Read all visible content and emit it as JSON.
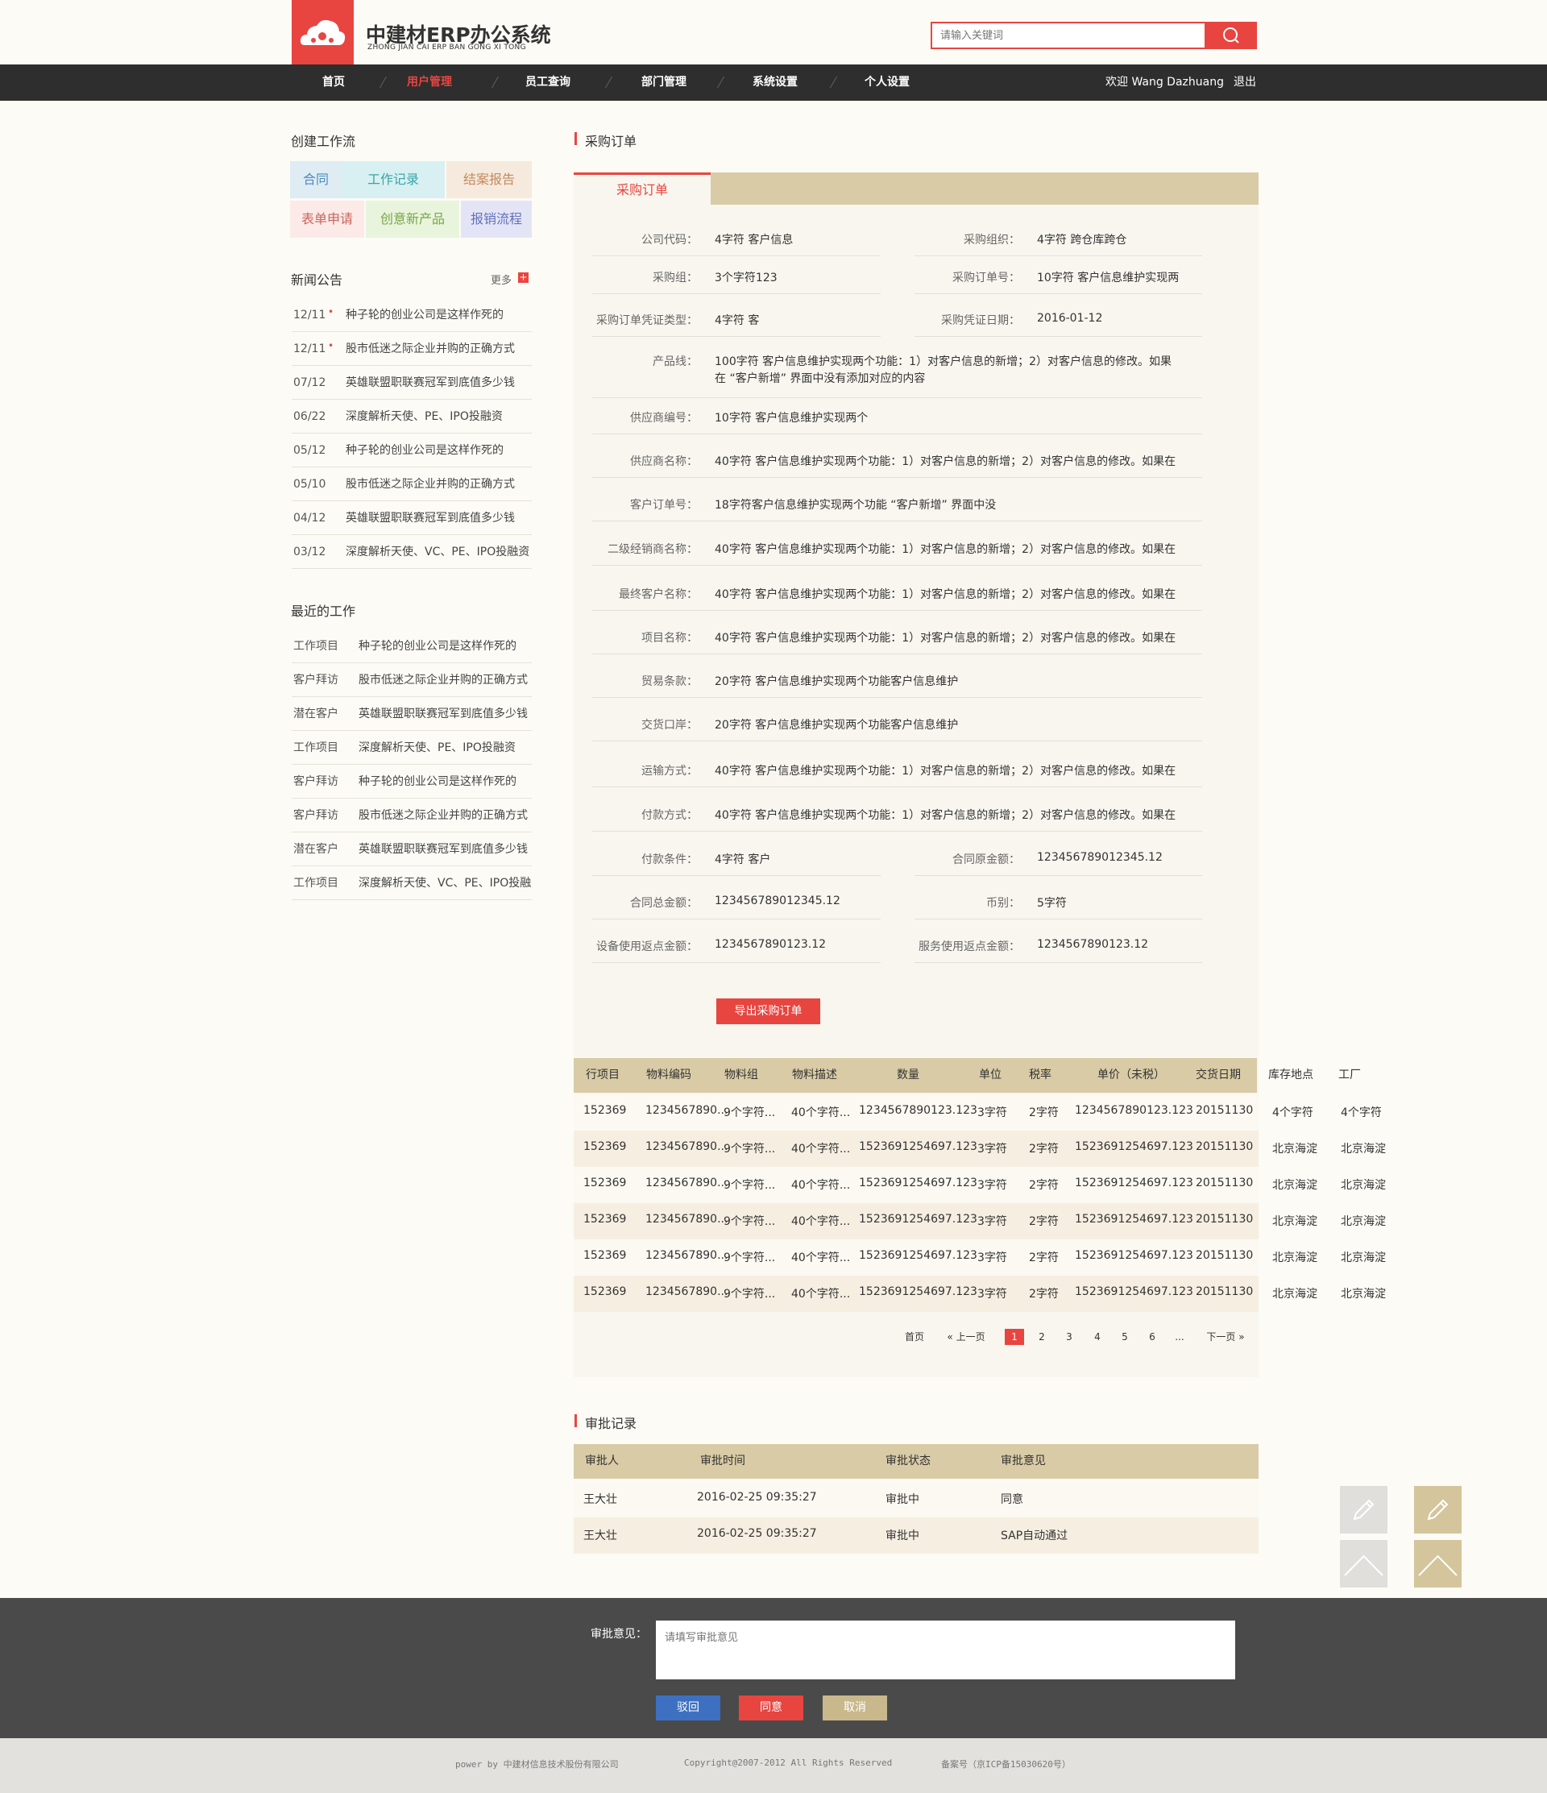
{
  "header": {
    "brand_title": "中建材ERP办公系统",
    "brand_sub": "ZHONG JIAN CAI ERP BAN GONG XI TONG",
    "search_placeholder": "请输入关键词"
  },
  "nav": {
    "items": [
      "首页",
      "用户管理",
      "员工查询",
      "部门管理",
      "系统设置",
      "个人设置"
    ],
    "active": "用户管理",
    "welcome": "欢迎 Wang Dazhuang",
    "logout": "退出"
  },
  "sidebar": {
    "workflow_title": "创建工作流",
    "workflow_tiles": [
      "合同",
      "工作记录",
      "结案报告",
      "表单申请",
      "创意新产品",
      "报销流程"
    ],
    "news_title": "新闻公告",
    "news_more": "更多",
    "news": [
      {
        "date": "12/11",
        "title": "种子轮的创业公司是这样作死的"
      },
      {
        "date": "12/11",
        "title": "股市低迷之际企业并购的正确方式"
      },
      {
        "date": "07/12",
        "title": "英雄联盟职联赛冠军到底值多少钱"
      },
      {
        "date": "06/22",
        "title": "深度解析天使、PE、IPO投融资"
      },
      {
        "date": "05/12",
        "title": "种子轮的创业公司是这样作死的"
      },
      {
        "date": "05/10",
        "title": "股市低迷之际企业并购的正确方式"
      },
      {
        "date": "04/12",
        "title": "英雄联盟职联赛冠军到底值多少钱"
      },
      {
        "date": "03/12",
        "title": "深度解析天使、VC、PE、IPO投融资"
      }
    ],
    "work_title": "最近的工作",
    "work": [
      {
        "type": "工作项目",
        "title": "种子轮的创业公司是这样作死的"
      },
      {
        "type": "客户拜访",
        "title": "股市低迷之际企业并购的正确方式"
      },
      {
        "type": "潜在客户",
        "title": "英雄联盟职联赛冠军到底值多少钱"
      },
      {
        "type": "工作项目",
        "title": "深度解析天使、PE、IPO投融资"
      },
      {
        "type": "客户拜访",
        "title": "种子轮的创业公司是这样作死的"
      },
      {
        "type": "客户拜访",
        "title": "股市低迷之际企业并购的正确方式"
      },
      {
        "type": "潜在客户",
        "title": "英雄联盟职联赛冠军到底值多少钱"
      },
      {
        "type": "工作项目",
        "title": "深度解析天使、VC、PE、IPO投融"
      }
    ]
  },
  "order": {
    "section_title": "采购订单",
    "tab_label": "采购订单",
    "fields": {
      "company_code": {
        "label": "公司代码：",
        "value": "4字符  客户信息"
      },
      "purchase_org": {
        "label": "采购组织：",
        "value": "4字符   跨仓库跨仓"
      },
      "purchase_group": {
        "label": "采购组：",
        "value": "3个字符123"
      },
      "order_no": {
        "label": "采购订单号：",
        "value": "10字符  客户信息维护实现两"
      },
      "voucher_type": {
        "label": "采购订单凭证类型：",
        "value": "4字符   客"
      },
      "voucher_date": {
        "label": "采购凭证日期：",
        "value": "2016-01-12"
      },
      "product_line": {
        "label": "产品线：",
        "value1": "100字符  客户信息维护实现两个功能：1）对客户信息的新增；2）对客户信息的修改。如果",
        "value2": "在 “客户新增” 界面中没有添加对应的内容"
      },
      "supplier_no": {
        "label": "供应商编号：",
        "value": "10字符 客户信息维护实现两个"
      },
      "supplier_name": {
        "label": "供应商名称：",
        "value": "40字符  客户信息维护实现两个功能：1）对客户信息的新增；2）对客户信息的修改。如果在"
      },
      "customer_order_no": {
        "label": "客户订单号：",
        "value": "18字符客户信息维护实现两个功能  “客户新增” 界面中没"
      },
      "dealer_name": {
        "label": "二级经销商名称：",
        "value": "40字符  客户信息维护实现两个功能：1）对客户信息的新增；2）对客户信息的修改。如果在"
      },
      "end_customer": {
        "label": "最终客户名称：",
        "value": "40字符  客户信息维护实现两个功能：1）对客户信息的新增；2）对客户信息的修改。如果在"
      },
      "project_name": {
        "label": "项目名称：",
        "value": "40字符  客户信息维护实现两个功能：1）对客户信息的新增；2）对客户信息的修改。如果在"
      },
      "trade_terms": {
        "label": "贸易条款：",
        "value": "20字符 客户信息维护实现两个功能客户信息维护"
      },
      "delivery_port": {
        "label": "交货口岸：",
        "value": "20字符 客户信息维护实现两个功能客户信息维护"
      },
      "shipping": {
        "label": "运输方式：",
        "value": "40字符  客户信息维护实现两个功能：1）对客户信息的新增；2）对客户信息的修改。如果在"
      },
      "payment_method": {
        "label": "付款方式：",
        "value": "40字符  客户信息维护实现两个功能：1）对客户信息的新增；2）对客户信息的修改。如果在"
      },
      "payment_terms": {
        "label": "付款条件：",
        "value": "4字符 客户"
      },
      "contract_original": {
        "label": "合同原金额：",
        "value": "123456789012345.12"
      },
      "contract_total": {
        "label": "合同总金额：",
        "value": "123456789012345.12"
      },
      "currency": {
        "label": "币别：",
        "value": "5字符"
      },
      "equip_rebate": {
        "label": "设备使用返点金额：",
        "value": "1234567890123.12"
      },
      "service_rebate": {
        "label": "服务使用返点金额：",
        "value": "1234567890123.12"
      }
    },
    "export_button": "导出采购订单"
  },
  "items_table": {
    "headers": [
      "行项目",
      "物料编码",
      "物料组",
      "物料描述",
      "数量",
      "单位",
      "税率",
      "单价（未税）",
      "交货日期",
      "库存地点",
      "工厂"
    ],
    "rows": [
      [
        "152369",
        "1234567890...",
        "9个字符...",
        "40个字符...",
        "1234567890123.123",
        "3字符",
        "2字符",
        "1234567890123.123",
        "20151130",
        "4个字符",
        "4个字符"
      ],
      [
        "152369",
        "1234567890...",
        "9个字符...",
        "40个字符...",
        "1523691254697.123",
        "3字符",
        "2字符",
        "1523691254697.123",
        "20151130",
        "北京海淀",
        "北京海淀"
      ],
      [
        "152369",
        "1234567890...",
        "9个字符...",
        "40个字符...",
        "1523691254697.123",
        "3字符",
        "2字符",
        "1523691254697.123",
        "20151130",
        "北京海淀",
        "北京海淀"
      ],
      [
        "152369",
        "1234567890...",
        "9个字符...",
        "40个字符...",
        "1523691254697.123",
        "3字符",
        "2字符",
        "1523691254697.123",
        "20151130",
        "北京海淀",
        "北京海淀"
      ],
      [
        "152369",
        "1234567890...",
        "9个字符...",
        "40个字符...",
        "1523691254697.123",
        "3字符",
        "2字符",
        "1523691254697.123",
        "20151130",
        "北京海淀",
        "北京海淀"
      ],
      [
        "152369",
        "1234567890...",
        "9个字符...",
        "40个字符...",
        "1523691254697.123",
        "3字符",
        "2字符",
        "1523691254697.123",
        "20151130",
        "北京海淀",
        "北京海淀"
      ]
    ],
    "pagination": {
      "first": "首页",
      "prev": "« 上一页",
      "pages": [
        "1",
        "2",
        "3",
        "4",
        "5",
        "6",
        "..."
      ],
      "current": "1",
      "next": "下一页 »"
    }
  },
  "approval": {
    "section_title": "审批记录",
    "headers": [
      "审批人",
      "审批时间",
      "审批状态",
      "审批意见"
    ],
    "rows": [
      [
        "王大壮",
        "2016-02-25  09:35:27",
        "审批中",
        "同意"
      ],
      [
        "王大壮",
        "2016-02-25  09:35:27",
        "审批中",
        "SAP自动通过"
      ]
    ]
  },
  "footer": {
    "opinion_label": "审批意见：",
    "opinion_placeholder": "请填写审批意见",
    "reject": "驳回",
    "agree": "同意",
    "cancel": "取消",
    "power": "power by 中建材信息技术股份有限公司",
    "copyright": "Copyright@2007-2012 All Rights Reserved",
    "icp": "备案号（京ICP备15030620号）"
  },
  "colors": {
    "accent": "#e84540",
    "tan": "#d9cba5",
    "nav_bg": "#2e2e2e",
    "footer_bg": "#4a4a4a",
    "reject_blue": "#3d70c0",
    "cancel_tan": "#c9b88c"
  },
  "icons": [
    "cloud-logo-icon",
    "search-icon",
    "plus-icon",
    "pencil-icon",
    "chevron-up-icon"
  ]
}
